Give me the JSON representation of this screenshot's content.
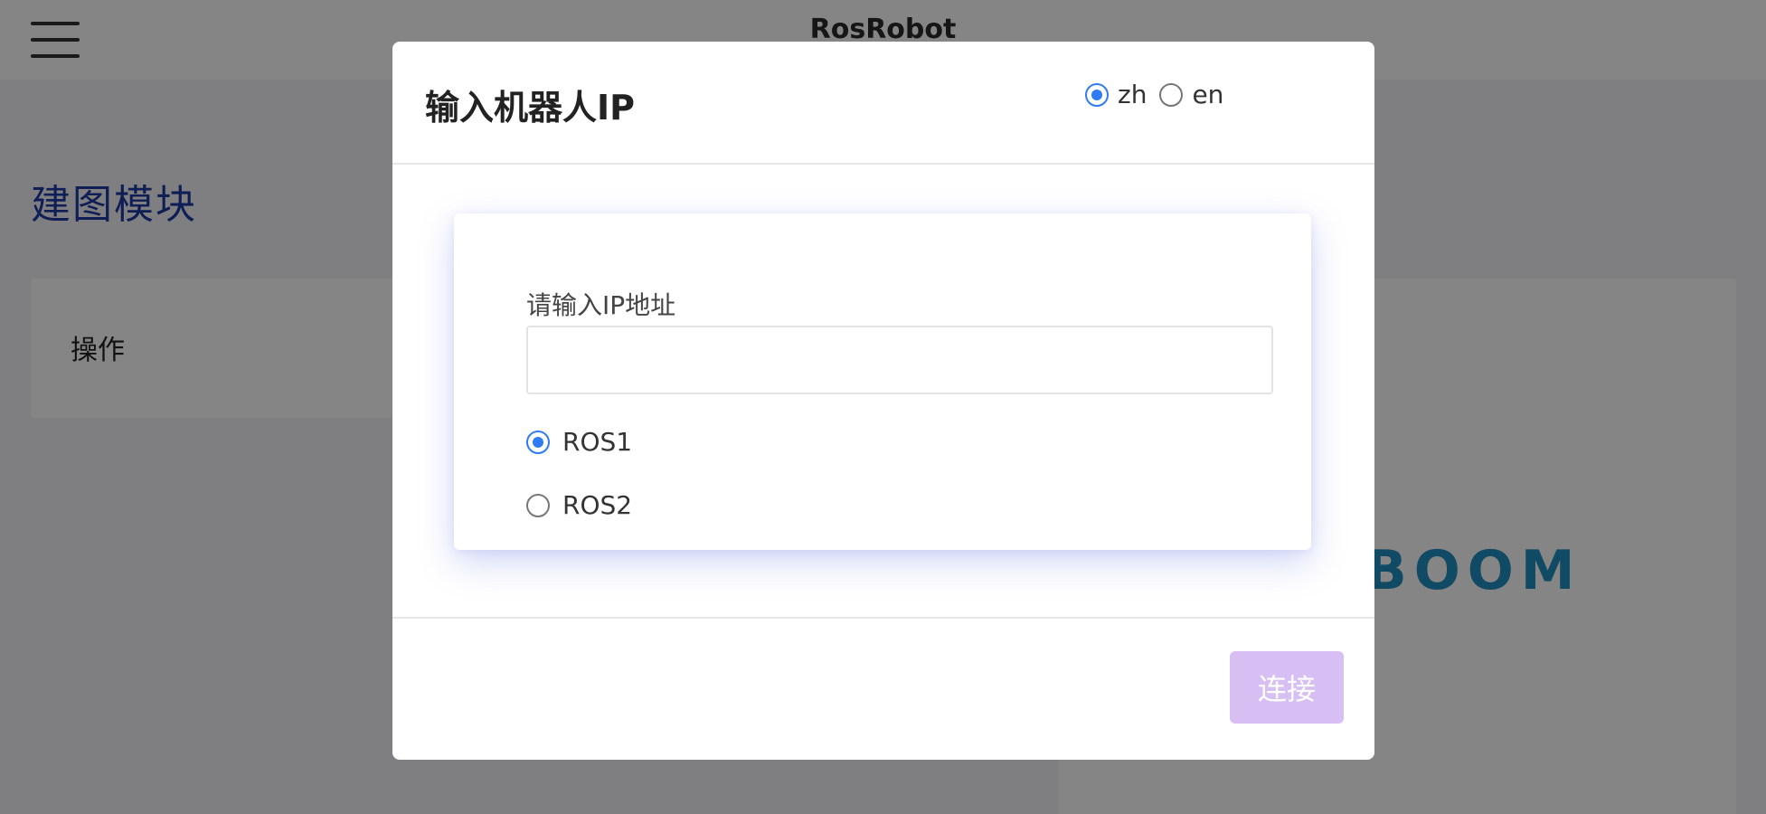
{
  "app": {
    "title": "RosRobot"
  },
  "page": {
    "section_title": "建图模块",
    "operations_label": "操作",
    "logo_text": "BOOM",
    "logo_color": "#1f8fc0"
  },
  "dialog": {
    "title": "输入机器人IP",
    "language": {
      "selected": "zh",
      "options": [
        {
          "label": "zh",
          "checked": true
        },
        {
          "label": "en",
          "checked": false
        }
      ]
    },
    "form": {
      "ip_label": "请输入IP地址",
      "ip_value": "",
      "ros_options": [
        {
          "label": "ROS1",
          "checked": true
        },
        {
          "label": "ROS2",
          "checked": false
        }
      ]
    },
    "connect_label": "连接",
    "connect_disabled": true
  },
  "colors": {
    "accent": "#2f7bf6",
    "connect_button_disabled": "#d7bff4",
    "section_title": "#1f3aa6"
  },
  "icons": {
    "menu": "hamburger-menu-icon"
  }
}
